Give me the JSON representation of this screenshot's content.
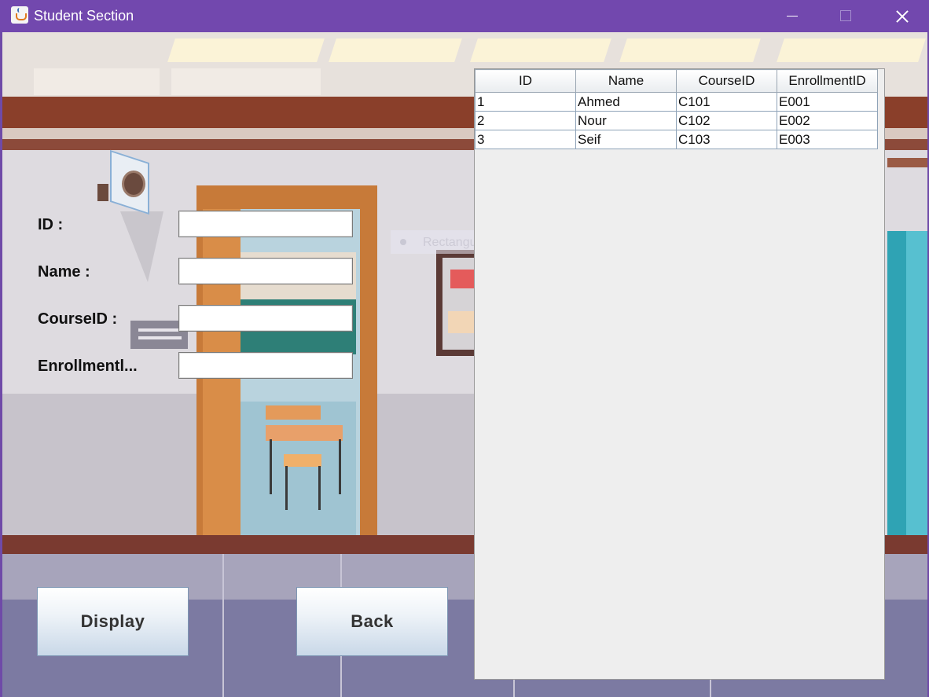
{
  "window": {
    "title": "Student Section",
    "icon": "java-cup-icon"
  },
  "form": {
    "id_label": "ID :",
    "name_label": "Name :",
    "course_label": "CourseID :",
    "enrollment_label": "Enrollmentl...",
    "id_value": "",
    "name_value": "",
    "course_value": "",
    "enrollment_value": ""
  },
  "buttons": {
    "display": "Display",
    "back": "Back"
  },
  "overlay": {
    "snip_text": "Rectangular Snip"
  },
  "table": {
    "columns": [
      "ID",
      "Name",
      "CourseID",
      "EnrollmentID"
    ],
    "rows": [
      [
        "1",
        "Ahmed",
        "C101",
        "E001"
      ],
      [
        "2",
        "Nour",
        "C102",
        "E002"
      ],
      [
        "3",
        "Seif",
        "C103",
        "E003"
      ]
    ]
  }
}
